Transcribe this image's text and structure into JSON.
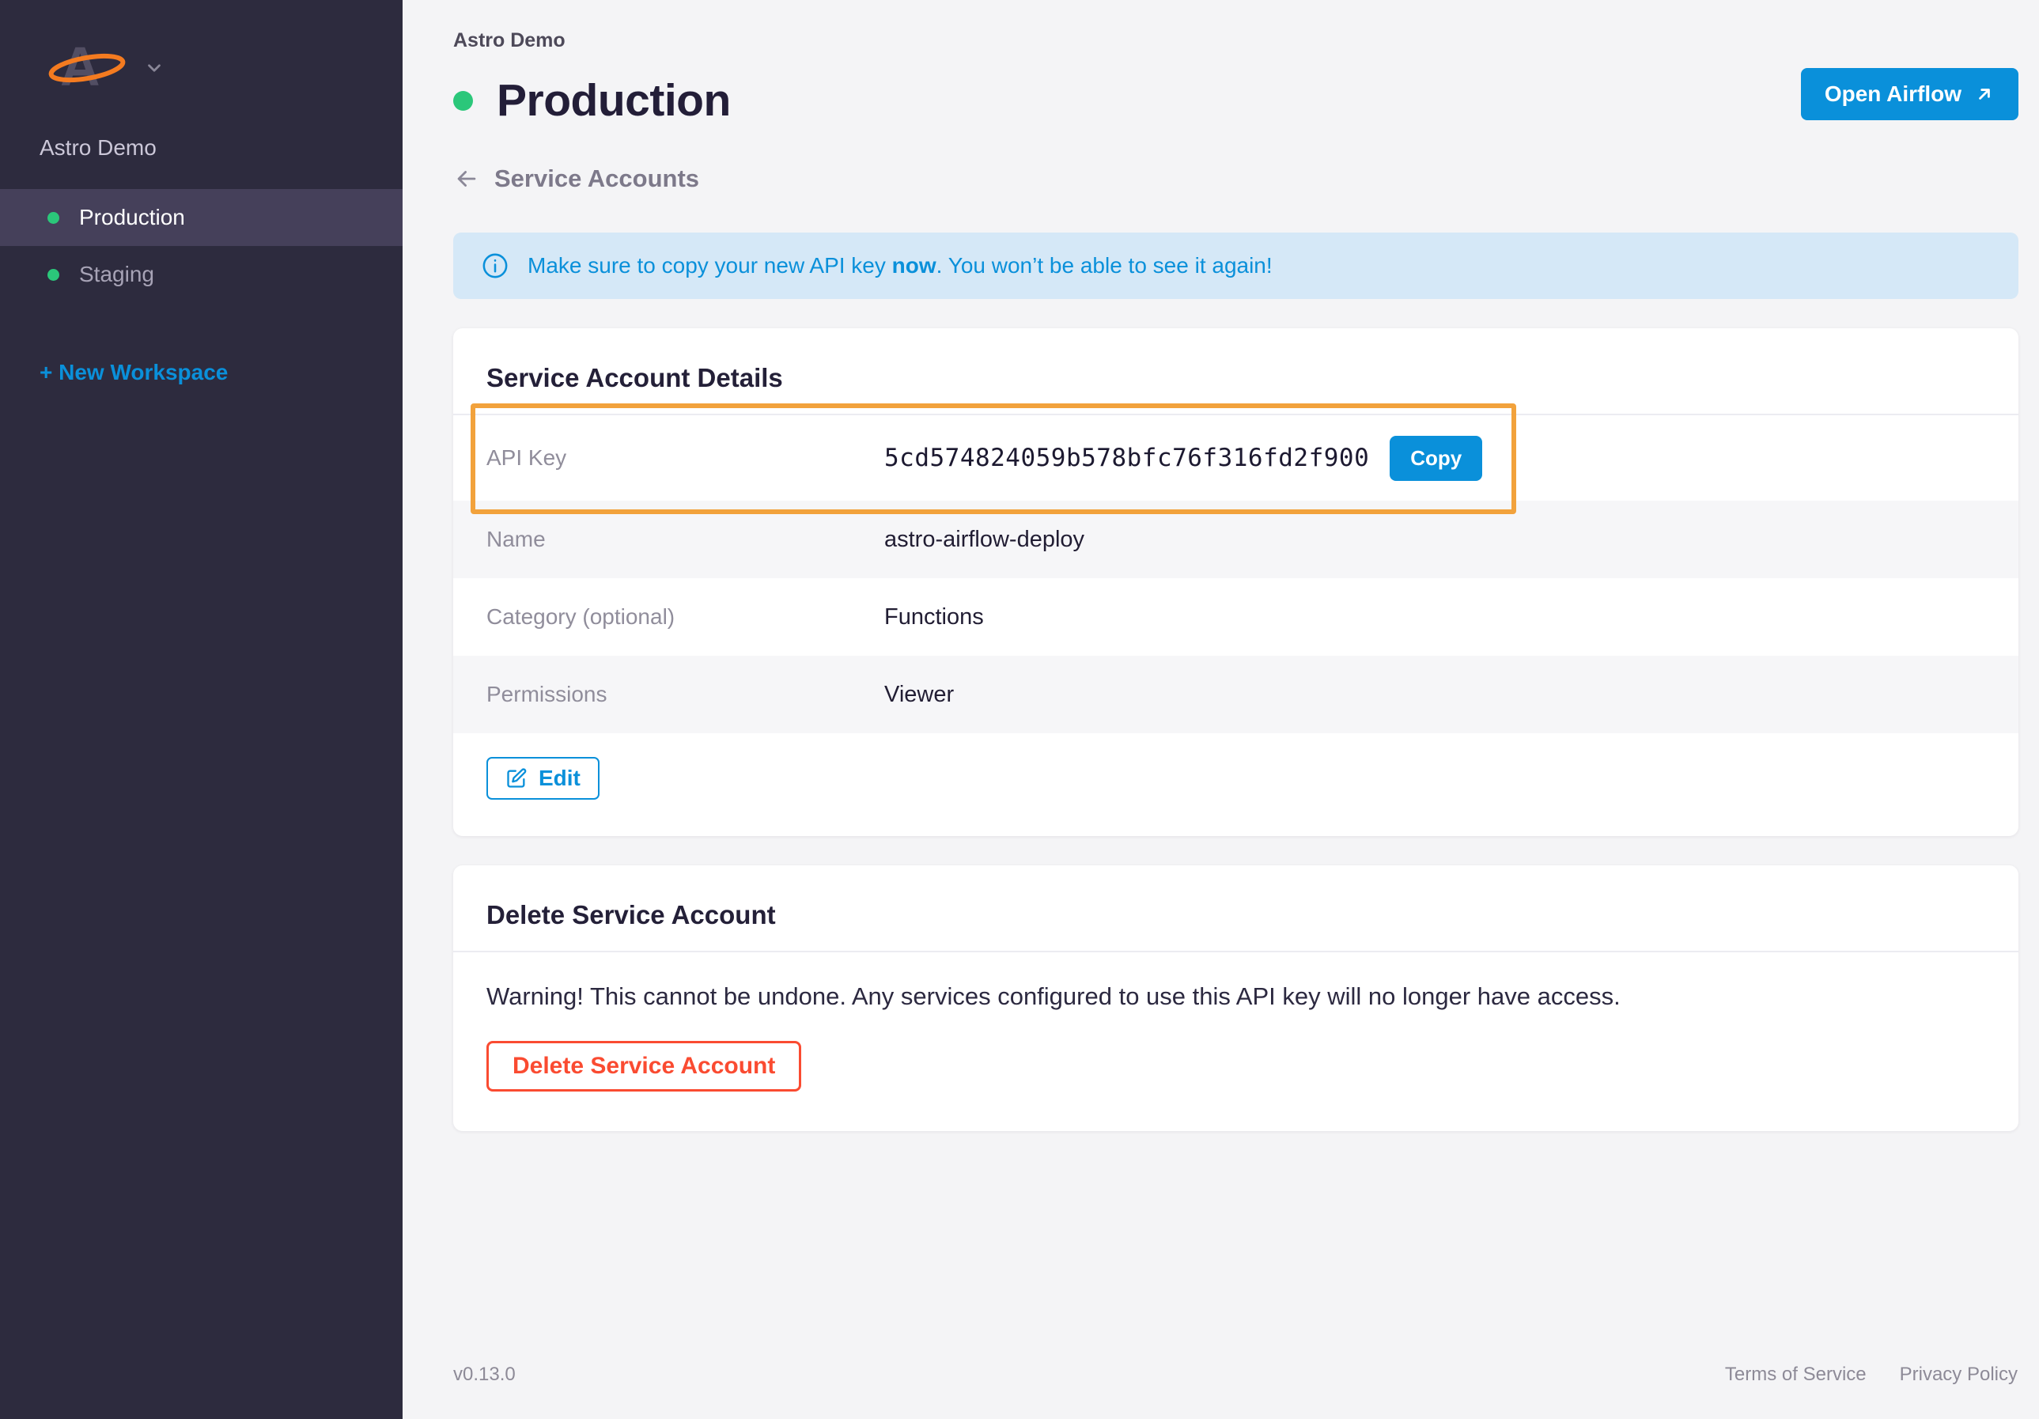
{
  "sidebar": {
    "workspace_name": "Astro Demo",
    "nav": [
      {
        "label": "Production",
        "active": true
      },
      {
        "label": "Staging",
        "active": false
      }
    ],
    "new_workspace_label": "+ New Workspace"
  },
  "header": {
    "breadcrumb": "Astro Demo",
    "title": "Production",
    "open_airflow_label": "Open Airflow",
    "back_label": "Service Accounts"
  },
  "banner": {
    "text_before": "Make sure to copy your new API key ",
    "text_bold": "now",
    "text_after": ". You won’t be able to see it again!"
  },
  "details_card": {
    "title": "Service Account Details",
    "rows": [
      {
        "label": "API Key",
        "value": "5cd574824059b578bfc76f316fd2f900"
      },
      {
        "label": "Name",
        "value": "astro-airflow-deploy"
      },
      {
        "label": "Category (optional)",
        "value": "Functions"
      },
      {
        "label": "Permissions",
        "value": "Viewer"
      }
    ],
    "copy_label": "Copy",
    "edit_label": "Edit"
  },
  "delete_card": {
    "title": "Delete Service Account",
    "warning": "Warning! This cannot be undone. Any services configured to use this API key will no longer have access.",
    "button_label": "Delete Service Account"
  },
  "footer": {
    "version": "v0.13.0",
    "links": [
      "Terms of Service",
      "Privacy Policy"
    ]
  },
  "colors": {
    "accent_blue": "#0a90da",
    "green": "#2bc77a",
    "highlight_orange": "#f2a23c",
    "delete_red": "#fa4b31",
    "sidebar_bg": "#2d2b3e",
    "banner_bg": "#d5e8f7"
  }
}
